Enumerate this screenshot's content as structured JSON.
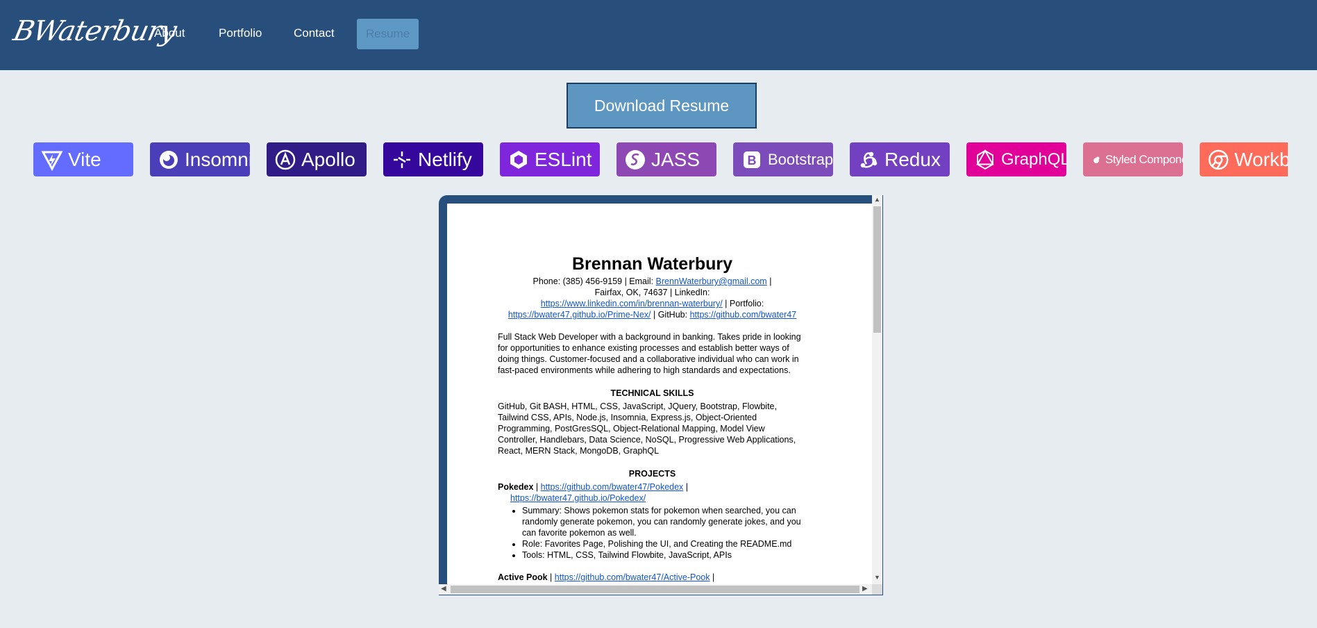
{
  "header": {
    "logo": "BWaterbury",
    "nav": [
      "About",
      "Portfolio",
      "Contact"
    ],
    "active": "Resume"
  },
  "download_label": "Download Resume",
  "badges": [
    {
      "label": "Vite",
      "color": "#646cff",
      "icon": "vite-icon"
    },
    {
      "label": "Insomnia",
      "color": "#4b3fb9",
      "icon": "insomnia-icon"
    },
    {
      "label": "Apollo",
      "color": "#311c87",
      "icon": "apollo-icon"
    },
    {
      "label": "Netlify",
      "color": "#36079c",
      "icon": "netlify-icon"
    },
    {
      "label": "ESLint",
      "color": "#7f26dd",
      "icon": "eslint-icon"
    },
    {
      "label": "JASS",
      "color": "#8d48b4",
      "icon": "jass-icon"
    },
    {
      "label": "Bootstrap",
      "color": "#7c4cbb",
      "icon": "bootstrap-icon"
    },
    {
      "label": "Redux",
      "color": "#7340c2",
      "icon": "redux-icon"
    },
    {
      "label": "GraphQL",
      "color": "#e10098",
      "icon": "graphql-icon"
    },
    {
      "label": "Styled Components",
      "color": "#db7093",
      "icon": "styled-components-icon"
    },
    {
      "label": "Workbox",
      "color": "#ff6b5b",
      "icon": "workbox-icon"
    }
  ],
  "resume": {
    "name": "Brennan Waterbury",
    "phone_prefix": "Phone: (385) 456-9159 | Email: ",
    "email": "BrennWaterbury@gmail.com",
    "sep1": " |",
    "location": "Fairfax, OK, 74637 | LinkedIn:",
    "linkedin": "https://www.linkedin.com/in/brennan-waterbury/",
    "portfolio_prefix": " | Portfolio:",
    "portfolio": "https://bwater47.github.io/Prime-Nex/",
    "github_prefix": " | GitHub: ",
    "github": "https://github.com/bwater47",
    "summary": "Full Stack Web Developer with a background in banking. Takes pride in looking for opportunities to enhance existing processes and establish better ways of doing things. Customer-focused and a collaborative individual who can work in fast-paced environments while adhering to high standards and expectations.",
    "skills_heading": "TECHNICAL SKILLS",
    "skills": "GitHub, Git BASH, HTML, CSS, JavaScript, JQuery, Bootstrap, Flowbite, Tailwind CSS, APIs, Node.js, Insomnia, Express.js, Object-Oriented Programming, PostGresSQL, Object-Relational Mapping, Model View Controller, Handlebars, Data Science, NoSQL, Progressive Web Applications, React, MERN Stack, MongoDB, GraphQL",
    "projects_heading": "PROJECTS",
    "project1": {
      "name": "Pokedex",
      "sep": " | ",
      "repo": "https://github.com/bwater47/Pokedex",
      "sep2": " |",
      "site": "https://bwater47.github.io/Pokedex/",
      "bullets": [
        "Summary: Shows pokemon stats for pokemon when searched, you can randomly generate pokemon, you can randomly generate jokes, and you can favorite pokemon as well.",
        "Role: Favorites Page, Polishing the UI, and Creating the README.md",
        "Tools: HTML, CSS, Tailwind Flowbite, JavaScript, APIs"
      ]
    },
    "project2": {
      "name": "Active Pook",
      "sep": " | ",
      "repo": "https://github.com/bwater47/Active-Pook",
      "sep2": " |"
    }
  }
}
